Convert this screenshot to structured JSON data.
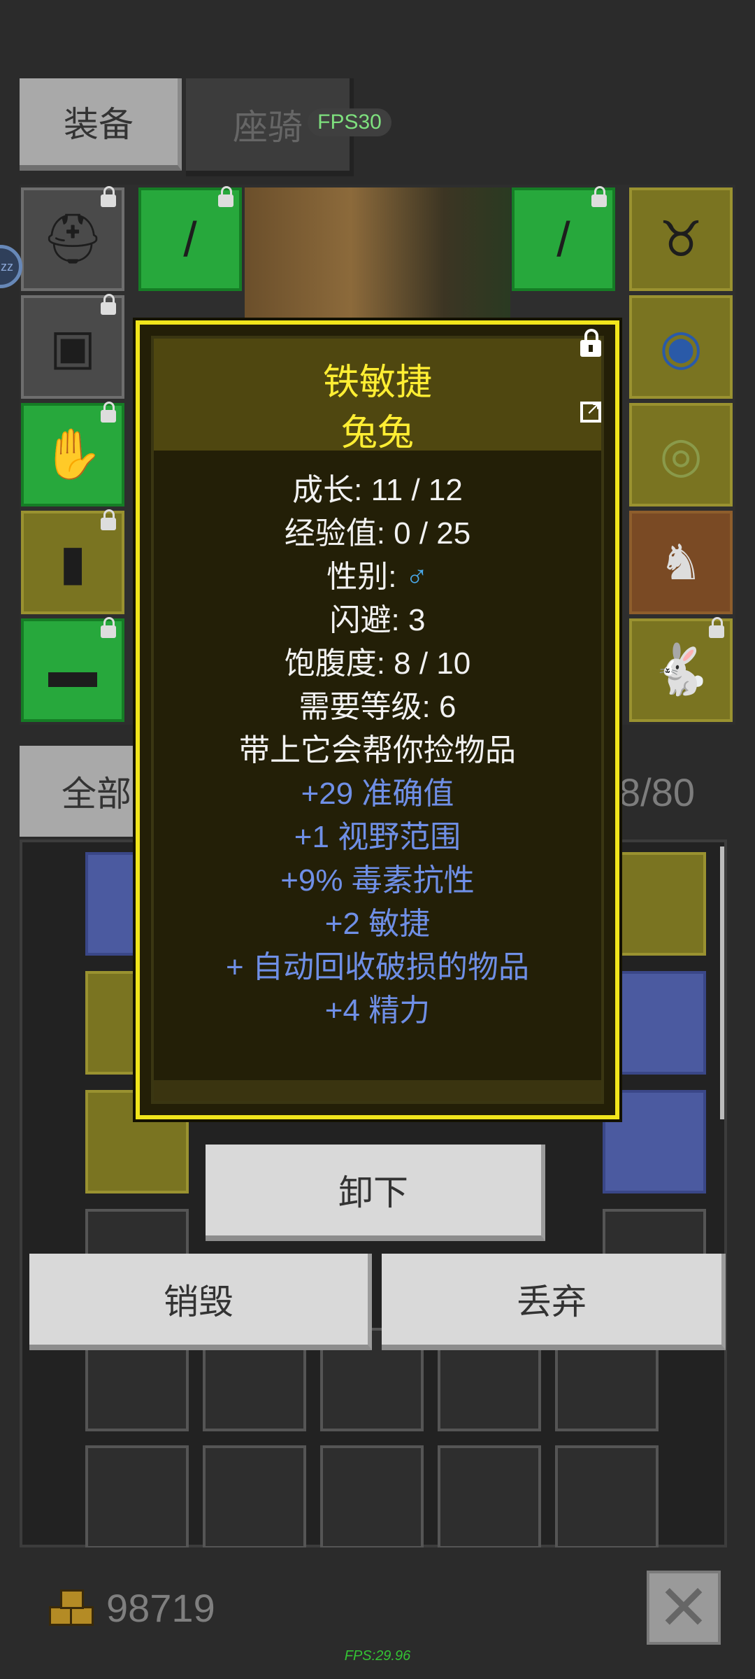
{
  "tabs": {
    "equipment": "装备",
    "mount": "座骑"
  },
  "fps_badge": "FPS30",
  "indicator": "zz",
  "item": {
    "title": "铁敏捷",
    "subtitle": "兔兔",
    "stats": [
      "成长: 11 / 12",
      "经验值: 0 / 25",
      "闪避: 3",
      "饱腹度: 8 / 10",
      "需要等级: 6",
      "带上它会帮你捡物品"
    ],
    "gender_label": "性别:",
    "gender_symbol": "♂",
    "bonuses": [
      "+29 准确值",
      "+1 视野范围",
      "+9% 毒素抗性",
      "+2 敏捷",
      "+ 自动回收破损的物品",
      "+4 精力"
    ]
  },
  "filter": {
    "all_label": "全部"
  },
  "inventory_count": "8/80",
  "buttons": {
    "unequip": "卸下",
    "destroy": "销毁",
    "discard": "丢弃"
  },
  "gold": "98719",
  "fps_footer": "FPS:29.96",
  "colors": {
    "popup_border": "#f1e51c",
    "title": "#ffee33",
    "bonus": "#6f8fe6",
    "male": "#4aa8e8"
  }
}
